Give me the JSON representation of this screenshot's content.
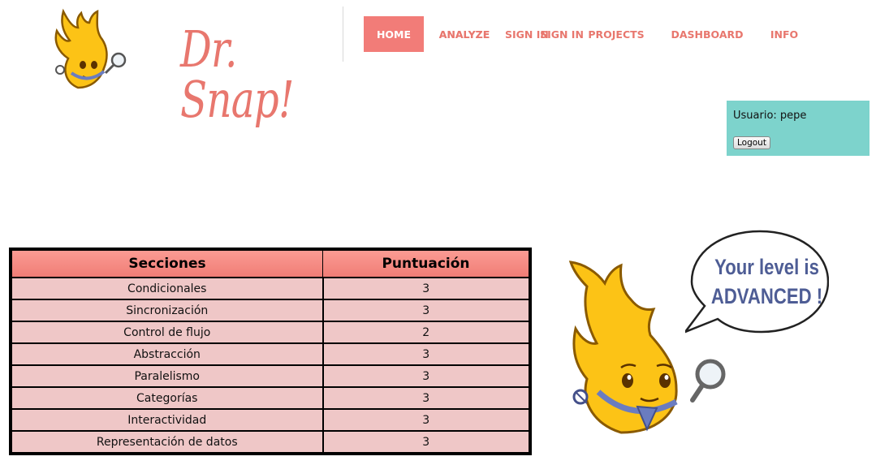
{
  "brand": {
    "logo_text": "Dr. Snap!"
  },
  "nav": {
    "items": [
      {
        "label": "HOME",
        "active": true
      },
      {
        "label": "ANALYZE",
        "active": false
      },
      {
        "label": "SIGN IN",
        "active": false
      },
      {
        "label": "PROJECTS",
        "active": false
      },
      {
        "label": "DASHBOARD",
        "active": false
      },
      {
        "label": "INFO",
        "active": false
      }
    ]
  },
  "user": {
    "label": "Usuario: pepe",
    "logout_label": "Logout"
  },
  "score_table": {
    "headers": [
      "Secciones",
      "Puntuación"
    ],
    "rows": [
      {
        "section": "Condicionales",
        "score": "3"
      },
      {
        "section": "Sincronización",
        "score": "3"
      },
      {
        "section": "Control de flujo",
        "score": "2"
      },
      {
        "section": "Abstracción",
        "score": "3"
      },
      {
        "section": "Paralelismo",
        "score": "3"
      },
      {
        "section": "Categorías",
        "score": "3"
      },
      {
        "section": "Interactividad",
        "score": "3"
      },
      {
        "section": "Representación de datos",
        "score": "3"
      }
    ]
  },
  "result": {
    "line1": "Your level is",
    "line2": "ADVANCED !"
  },
  "colors": {
    "accent": "#f27c78",
    "nav_text": "#e8776e",
    "user_box": "#7dd3cc",
    "table_row": "#efc7c7",
    "speech_text": "#4e5d95",
    "mascot": "#fcc316"
  },
  "icons": [
    "snap-mascot-icon",
    "magnifier-icon",
    "speech-bubble-icon"
  ]
}
